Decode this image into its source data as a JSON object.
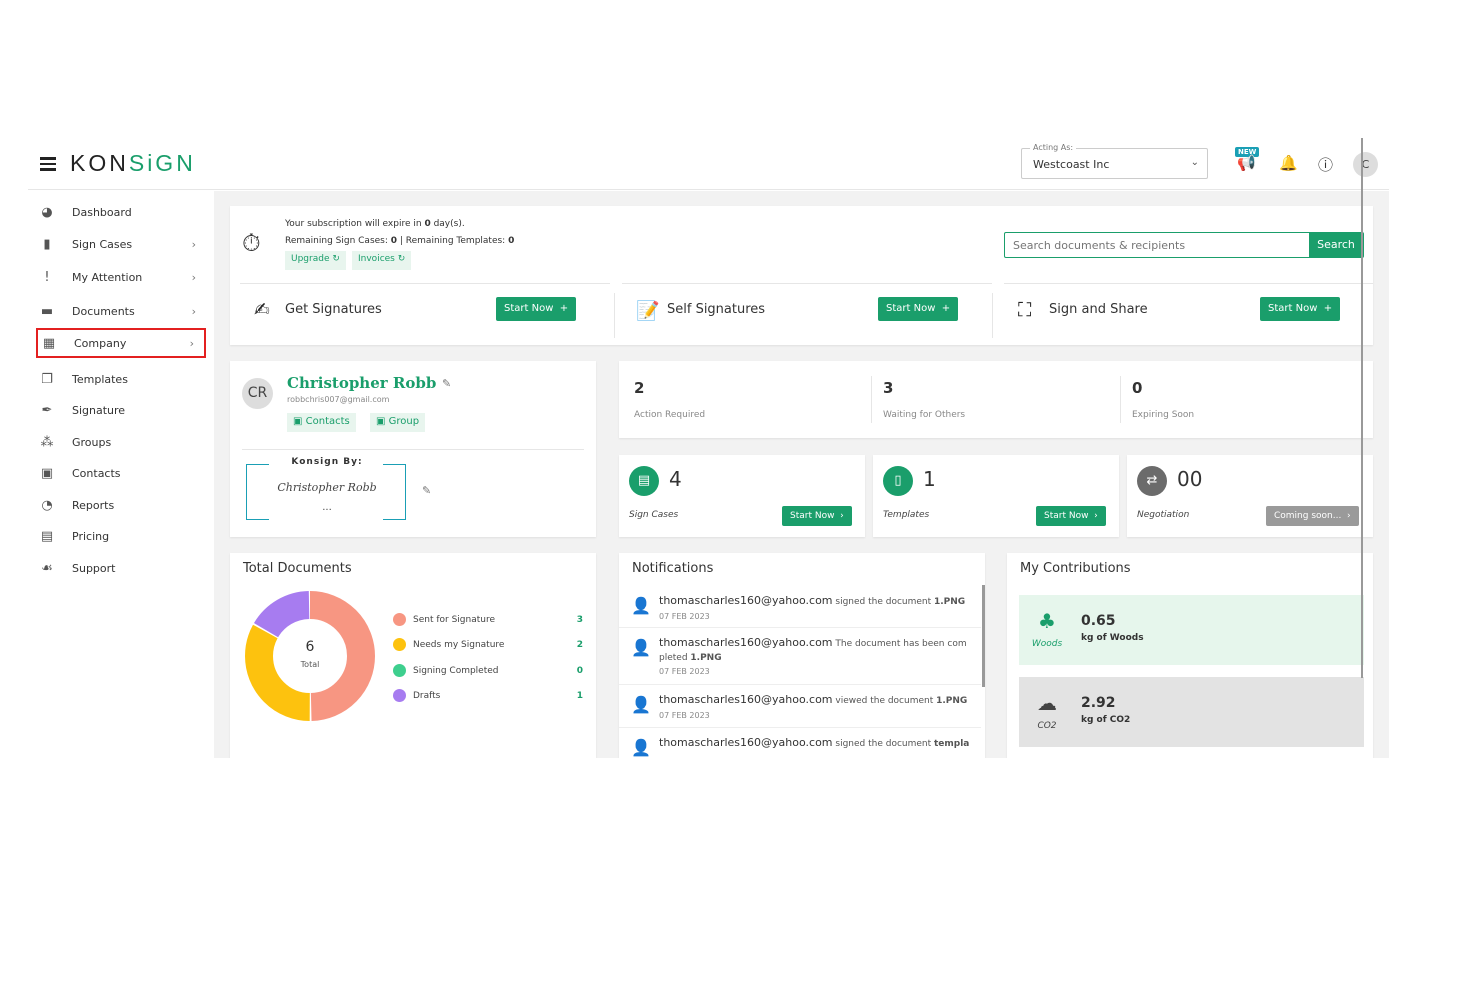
{
  "header": {
    "logo_k": "K",
    "logo_o": "O",
    "logo_n": "N",
    "logo_sign": "SiGN",
    "acting_label": "Acting As:",
    "acting_value": "Westcoast Inc",
    "new_badge": "NEW",
    "avatar": "C"
  },
  "sidebar": {
    "items": [
      {
        "label": "Dashboard",
        "icon": "dashboard-icon"
      },
      {
        "label": "Sign Cases",
        "icon": "briefcase-icon"
      },
      {
        "label": "My Attention",
        "icon": "exclamation-icon"
      },
      {
        "label": "Documents",
        "icon": "folder-icon"
      },
      {
        "label": "Company",
        "icon": "building-icon"
      },
      {
        "label": "Templates",
        "icon": "copy-icon"
      },
      {
        "label": "Signature",
        "icon": "pen-icon"
      },
      {
        "label": "Groups",
        "icon": "users-icon"
      },
      {
        "label": "Contacts",
        "icon": "contact-icon"
      },
      {
        "label": "Reports",
        "icon": "pie-icon"
      },
      {
        "label": "Pricing",
        "icon": "money-icon"
      },
      {
        "label": "Support",
        "icon": "handshake-icon"
      }
    ]
  },
  "subscription": {
    "line1_pre": "Your subscription will expire in ",
    "line1_num": "0",
    "line1_post": " day(s).",
    "line2_a": "Remaining Sign Cases: ",
    "line2_a_num": "0",
    "line2_b": " | Remaining Templates: ",
    "line2_b_num": "0",
    "upgrade": "Upgrade",
    "invoices": "Invoices"
  },
  "search": {
    "placeholder": "Search documents & recipients",
    "button": "Search"
  },
  "actions": [
    {
      "title": "Get Signatures",
      "button": "Start Now"
    },
    {
      "title": "Self Signatures",
      "button": "Start Now"
    },
    {
      "title": "Sign and Share",
      "button": "Start Now"
    }
  ],
  "profile": {
    "initials": "CR",
    "name": "Christopher Robb",
    "email": "robbchris007@gmail.com",
    "contacts": "Contacts",
    "group": "Group",
    "konsign_by": "Konsign By:",
    "signature": "Christopher Robb",
    "dots": "..."
  },
  "stats": [
    {
      "num": "2",
      "label": "Action Required"
    },
    {
      "num": "3",
      "label": "Waiting for Others"
    },
    {
      "num": "0",
      "label": "Expiring Soon"
    }
  ],
  "mini": [
    {
      "num": "4",
      "label": "Sign Cases",
      "button": "Start Now"
    },
    {
      "num": "1",
      "label": "Templates",
      "button": "Start Now"
    },
    {
      "num": "00",
      "label": "Negotiation",
      "button": "Coming soon..."
    }
  ],
  "total_documents": {
    "title": "Total Documents",
    "center_num": "6",
    "center_label": "Total"
  },
  "chart_data": {
    "type": "pie",
    "categories": [
      "Sent for Signature",
      "Needs my Signature",
      "Signing Completed",
      "Drafts"
    ],
    "values": [
      3,
      2,
      0,
      1
    ],
    "colors": [
      "#f79682",
      "#fdc20e",
      "#3ecf8e",
      "#a77cf0"
    ]
  },
  "notifications": {
    "title": "Notifications",
    "items": [
      {
        "email": "thomascharles160@yahoo.com",
        "text": " signed the document ",
        "doc": "1.PNG",
        "date": "07 FEB 2023"
      },
      {
        "email": "thomascharles160@yahoo.com",
        "text": " The document has been com pleted ",
        "doc": "1.PNG",
        "date": "07 FEB 2023"
      },
      {
        "email": "thomascharles160@yahoo.com",
        "text": " viewed the document ",
        "doc": "1.PNG",
        "date": "07 FEB 2023"
      },
      {
        "email": "thomascharles160@yahoo.com",
        "text": " signed the document ",
        "doc": "templa",
        "date": ""
      }
    ]
  },
  "contributions": {
    "title": "My Contributions",
    "items": [
      {
        "icon_label": "Woods",
        "value": "0.65",
        "unit": "kg of Woods"
      },
      {
        "icon_label": "CO2",
        "value": "2.92",
        "unit": "kg of CO2"
      }
    ]
  },
  "colors": {
    "brand": "#1a9e6b",
    "highlight": "#e32020"
  }
}
